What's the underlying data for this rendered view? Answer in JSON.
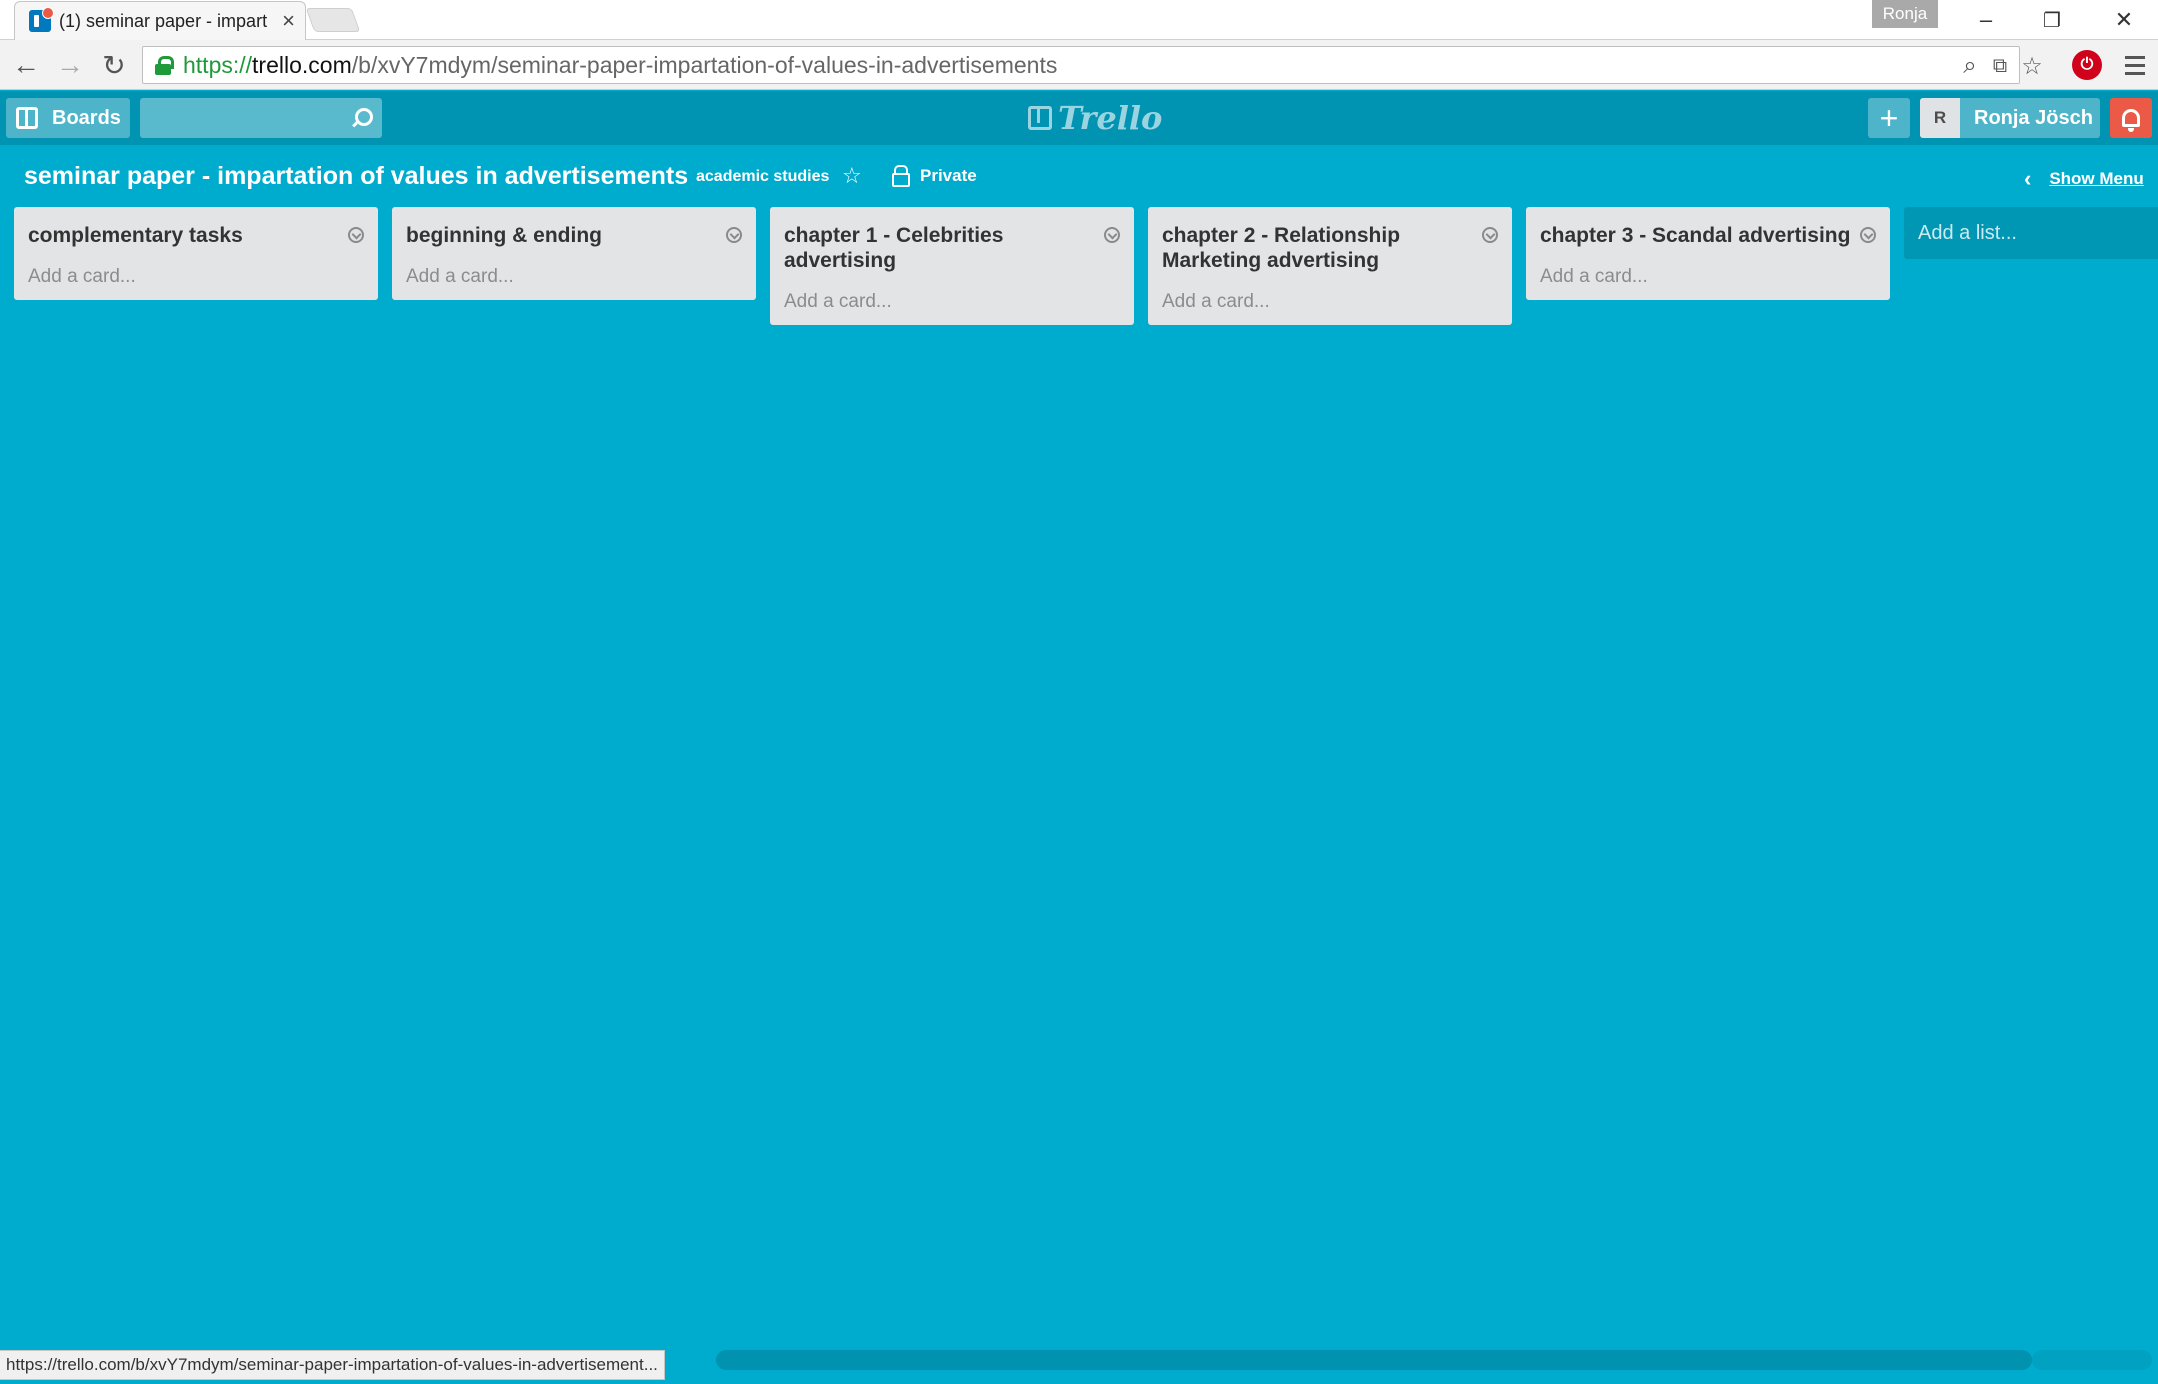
{
  "browser": {
    "tab_title": "(1) seminar paper - impart",
    "tab_close": "×",
    "profile_name": "Ronja",
    "window_controls": {
      "minimize": "–",
      "restore": "❐",
      "close": "✕"
    },
    "url_scheme": "https://",
    "url_host": "trello.com",
    "url_path": "/b/xvY7mdym/seminar-paper-impartation-of-values-in-advertisements",
    "nav": {
      "back": "←",
      "forward": "→",
      "reload": "↻"
    },
    "omni_icons": {
      "zoom": "⌕",
      "translate": "⧉",
      "bookmark": "☆"
    },
    "status_url": "https://trello.com/b/xvY7mdym/seminar-paper-impartation-of-values-in-advertisement..."
  },
  "header": {
    "boards_label": "Boards",
    "search_value": "",
    "logo_text": "Trello",
    "add_label": "+",
    "avatar_initial": "R",
    "user_name": "Ronja Jösch"
  },
  "board": {
    "title": "seminar paper - impartation of values in advertisements",
    "org": "academic studies",
    "star": "☆",
    "visibility": "Private",
    "show_menu_chevron": "‹",
    "show_menu": "Show Menu"
  },
  "lists": [
    {
      "title": "complementary tasks",
      "add_card": "Add a card..."
    },
    {
      "title": "beginning & ending",
      "add_card": "Add a card..."
    },
    {
      "title": "chapter 1 - Celebrities advertising",
      "add_card": "Add a card..."
    },
    {
      "title": "chapter 2 - Relationship Marketing advertising",
      "add_card": "Add a card..."
    },
    {
      "title": "chapter 3 - Scandal advertising",
      "add_card": "Add a card..."
    }
  ],
  "add_list": "Add a list...",
  "colors": {
    "board_bg": "#00acce",
    "header_bg": "#0094b2",
    "list_bg": "#e2e4e6",
    "notification": "#eb5a46"
  }
}
